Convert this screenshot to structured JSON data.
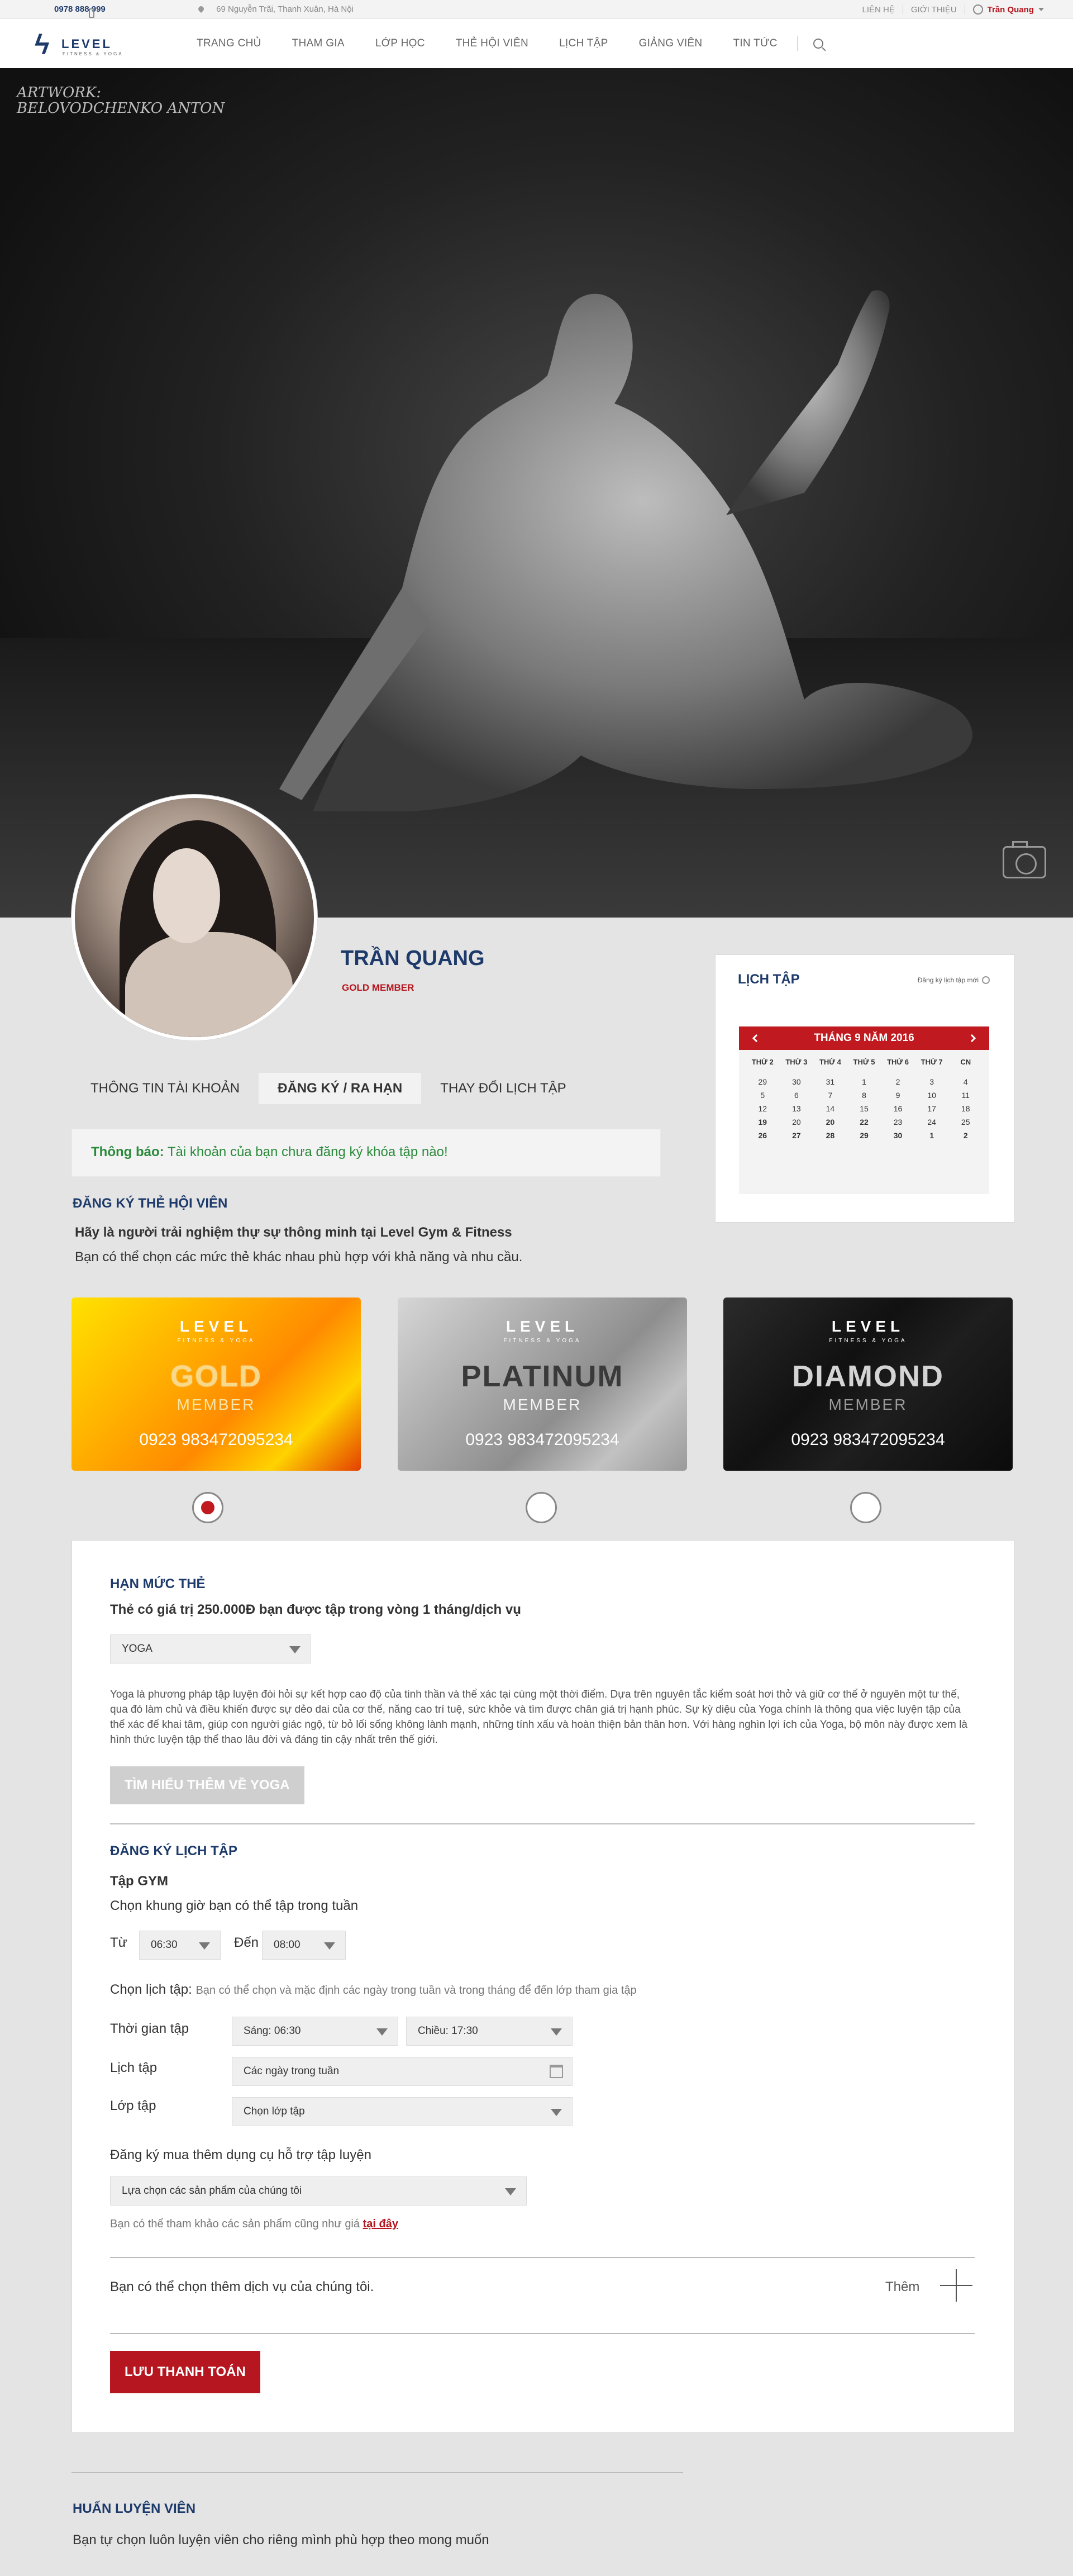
{
  "topbar": {
    "phone": "0978 888 999",
    "address": "69 Nguyễn Trãi, Thanh Xuân, Hà Nội",
    "links": [
      "LIÊN HỆ",
      "GIỚI THIỆU"
    ],
    "user": "Trần Quang"
  },
  "nav": {
    "logo_word": "LEVEL",
    "logo_sub": "FITNESS & YOGA",
    "items": [
      "TRANG CHỦ",
      "THAM GIA",
      "LỚP HỌC",
      "THẺ HỘI VIÊN",
      "LỊCH TẬP",
      "GIẢNG VIÊN",
      "TIN TỨC"
    ]
  },
  "hero": {
    "artwork_line1": "ARTWORK:",
    "artwork_line2": "BELOVODCHENKO ANTON"
  },
  "profile": {
    "name": "TRẦN QUANG",
    "level": "GOLD MEMBER"
  },
  "tabs": [
    "THÔNG TIN TÀI KHOẢN",
    "ĐĂNG KÝ / RA HẠN",
    "THAY ĐỔI LỊCH TẬP"
  ],
  "notice": {
    "label": "Thông báo:",
    "text": "Tài khoản của bạn chưa đăng ký khóa tập nào!"
  },
  "register": {
    "title": "ĐĂNG KÝ THẺ HỘI VIÊN",
    "lead": "Hãy là người trải nghiệm thự sự thông minh tại Level Gym & Fitness",
    "desc": "Bạn có thể chọn các mức thẻ khác nhau phù hợp với khả năng và nhu cầu."
  },
  "calendar": {
    "title": "LỊCH TẬP",
    "link": "Đăng ký lịch tập mới",
    "month": "THÁNG 9 NĂM 2016",
    "weekdays": [
      "THỨ 2",
      "THỨ 3",
      "THỨ 4",
      "THỨ 5",
      "THỨ 6",
      "THỨ 7",
      "CN"
    ],
    "days": [
      "29",
      "30",
      "31",
      "1",
      "2",
      "3",
      "4",
      "5",
      "6",
      "7",
      "8",
      "9",
      "10",
      "11",
      "12",
      "13",
      "14",
      "15",
      "16",
      "17",
      "18",
      "19",
      "20",
      "20",
      "22",
      "23",
      "24",
      "25",
      "26",
      "27",
      "28",
      "29",
      "30",
      "1",
      "2"
    ]
  },
  "cards": [
    {
      "brand": "LEVEL",
      "sub": "FITNESS & YOGA",
      "name": "GOLD",
      "member": "MEMBER",
      "number": "0923 983472095234"
    },
    {
      "brand": "LEVEL",
      "sub": "FITNESS & YOGA",
      "name": "PLATINUM",
      "member": "MEMBER",
      "number": "0923 983472095234"
    },
    {
      "brand": "LEVEL",
      "sub": "FITNESS & YOGA",
      "name": "DIAMOND",
      "member": "MEMBER",
      "number": "0923 983472095234"
    }
  ],
  "limit": {
    "title": "HẠN MỨC THẺ",
    "text": "Thẻ có giá trị  250.000Đ bạn được tập trong vòng 1 tháng/dịch vụ",
    "select": "YOGA",
    "desc": "Yoga là phương pháp tập luyện đòi hỏi sự kết hợp cao độ của tinh thần và thể xác tại cùng một thời điểm. Dựa trên nguyên tắc kiểm soát hơi thở và giữ cơ thể ở nguyên một tư thế, qua đó làm chủ và điều khiển được sự dẻo dai của cơ thể, năng cao trí tuệ, sức khỏe và tìm được chân giá trị hạnh phúc. Sự kỳ diệu của Yoga chính là thông qua việc luyện tập của thể xác để khai tâm, giúp con người giác ngộ, từ bỏ lối sống không lành mạnh, những tính xấu và hoàn thiện bản thân hơn. Với hàng nghìn lợi ích của Yoga, bộ môn này được xem là hình thức luyện tập thể thao lâu đời và đáng tin cậy nhất trên thế giới.",
    "button": "TÌM HIỂU THÊM VỀ YOGA"
  },
  "schedule": {
    "title": "ĐĂNG KÝ LỊCH TẬP",
    "gym": "Tập GYM",
    "gym_desc": "Chọn khung giờ bạn có thể tập trong tuần",
    "from_label": "Từ",
    "from_value": "06:30",
    "to_label": "Đến",
    "to_value": "08:00",
    "choose_label": "Chọn lịch tập:",
    "choose_hint": "Bạn có thể chọn và mặc định các ngày trong tuần và trong tháng để đến lớp tham gia tập",
    "time_label": "Thời gian tập",
    "time_am": "Sáng: 06:30",
    "time_pm": "Chiều: 17:30",
    "days_label": "Lịch tập",
    "days_value": "Các ngày trong tuần",
    "class_label": "Lớp tập",
    "class_value": "Chọn lớp tập",
    "extra_label": "Đăng ký mua thêm dụng cụ hỗ trợ tập luyện",
    "extra_value": "Lựa chọn các sản phẩm của chúng tôi",
    "ref_text": "Bạn có thể tham khảo các sản phẩm cũng như giá",
    "ref_link": "tại đây",
    "more_text": "Bạn có thể chọn thêm dịch vụ của chúng tôi.",
    "more_btn": "Thêm",
    "save": "LƯU THANH TOÁN"
  },
  "coach": {
    "title": "HUẤN LUYỆN VIÊN",
    "desc": "Bạn tự chọn luôn luyện viên cho riêng mình phù hợp theo mong muốn"
  }
}
